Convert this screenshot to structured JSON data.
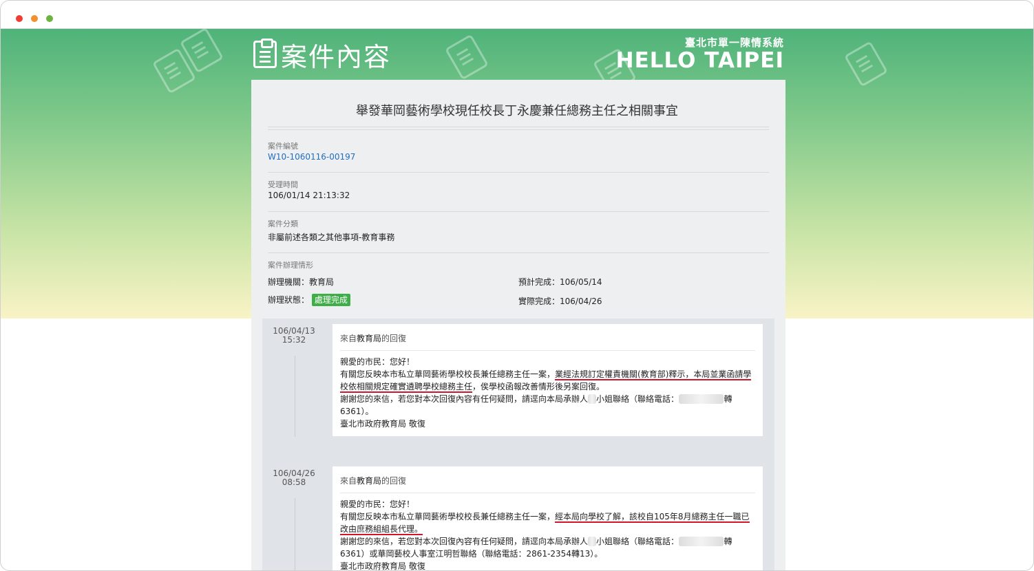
{
  "header": {
    "page_title": "案件內容",
    "brand_sub": "臺北市單一陳情系統",
    "brand_main": "HELLO TAIPEI"
  },
  "case": {
    "title": "舉發華岡藝術學校現任校長丁永慶兼任總務主任之相關事宜",
    "number_label": "案件編號",
    "number": "W10-1060116-00197",
    "received_label": "受理時間",
    "received": "106/01/14 21:13:32",
    "category_label": "案件分類",
    "category": "非屬前述各類之其他事項-教育事務",
    "handling_label": "案件辦理情形",
    "agency_label": "辦理機關：",
    "agency": "教育局",
    "status_label": "辦理狀態：",
    "status": "處理完成",
    "expected_label": "預計完成：",
    "expected": "106/05/14",
    "actual_label": "實際完成：",
    "actual": "106/04/26"
  },
  "replies": [
    {
      "date": "106/04/13",
      "time": "15:32",
      "from_prefix": "來自",
      "from": "教育局",
      "from_suffix": "的回復",
      "greeting": "親愛的市民：您好！",
      "p1_a": "有關您反映本市私立華岡藝術學校校長兼任總務主任一案，",
      "p1_u": "業經法規訂定權責機關(教育部)釋示，本局並業函請學校依相關規定確實遴聘學校總務主任",
      "p1_b": "，俟學校函報改善情形後另案回復。",
      "p2_a": "謝謝您的來信，若您對本次回復內容有任何疑問，請逕向本局承辦人",
      "p2_blur1": "王",
      "p2_b": "小姐聯絡（聯絡電話：",
      "p2_blur2": "2720-8889",
      "p2_c": "轉6361）。",
      "sign": "臺北市政府教育局 敬復"
    },
    {
      "date": "106/04/26",
      "time": "08:58",
      "from_prefix": "來自",
      "from": "教育局",
      "from_suffix": "的回復",
      "greeting": "親愛的市民：您好！",
      "p1_a": "有關您反映本市私立華岡藝術學校校長兼任總務主任一案，",
      "p1_u": "經本局向學校了解，該校自105年8月總務主任一職已改由庶務組組長代理。",
      "p1_b": "",
      "p2_a": "謝謝您的來信，若您對本次回復內容有任何疑問，請逕向本局承辦人",
      "p2_blur1": "王",
      "p2_b": "小姐聯絡（聯絡電話：",
      "p2_blur2": "2720-8889",
      "p2_c": "轉6361）或華岡藝校人事室江明哲聯絡（聯絡電話：2861-2354轉13）。",
      "sign": "臺北市政府教育局 敬復"
    }
  ]
}
